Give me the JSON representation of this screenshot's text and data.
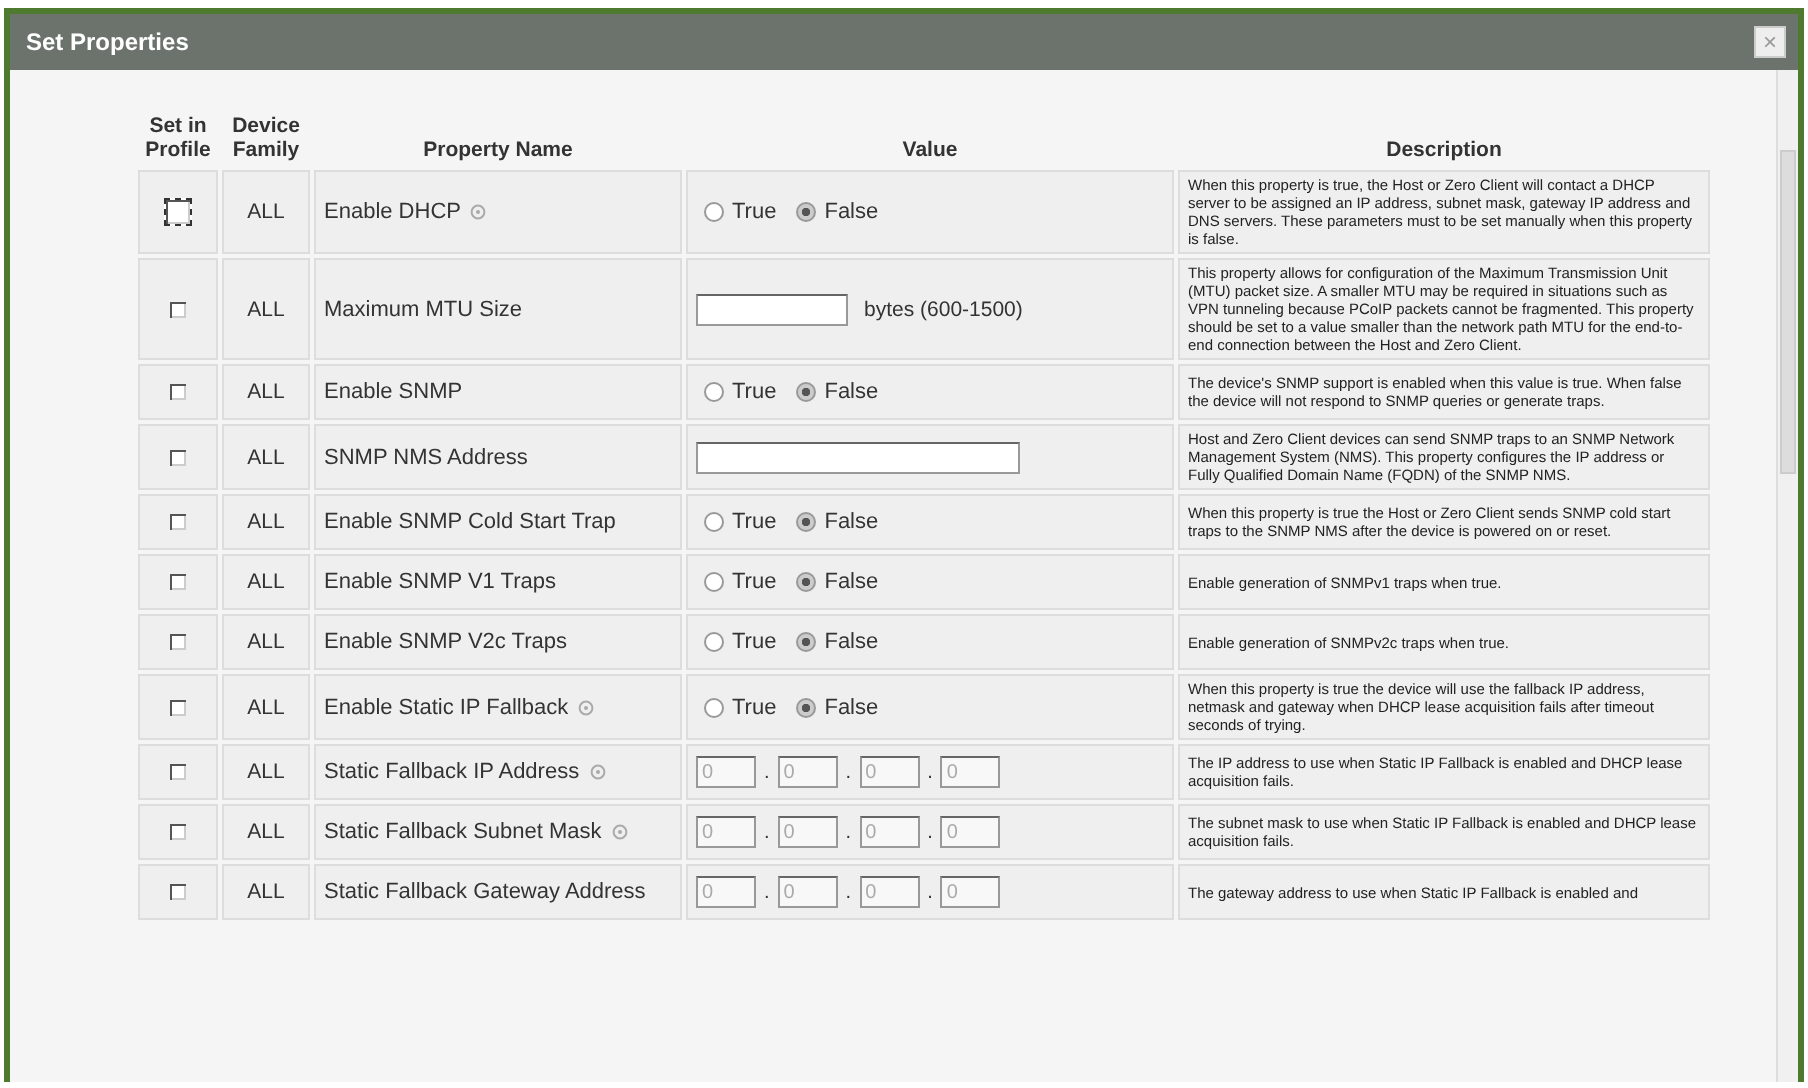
{
  "window": {
    "title": "Set Properties",
    "close": "×"
  },
  "columns": [
    "Set in Profile",
    "Device Family",
    "Property Name",
    "Value",
    "Description"
  ],
  "rows": [
    {
      "kind": "radio",
      "in_profile": false,
      "focused": true,
      "family": "ALL",
      "name": "Enable DHCP",
      "info": true,
      "options": [
        {
          "label": "True",
          "selected": false
        },
        {
          "label": "False",
          "selected": true
        }
      ],
      "description": "When this property is true, the Host or Zero Client will contact a DHCP server to be assigned an IP address, subnet mask, gateway IP address and DNS servers. These parameters must to be set manually when this property is false."
    },
    {
      "kind": "number",
      "in_profile": false,
      "focused": false,
      "family": "ALL",
      "name": "Maximum MTU Size",
      "info": false,
      "unit": "bytes (600-1500)",
      "description": "This property allows for configuration of the Maximum Transmission Unit (MTU) packet size. A smaller MTU may be required in situations such as VPN tunneling because PCoIP packets cannot be fragmented. This property should be set to a value smaller than the network path MTU for the end-to-end connection between the Host and Zero Client."
    },
    {
      "kind": "radio",
      "in_profile": false,
      "focused": false,
      "family": "ALL",
      "name": "Enable SNMP",
      "info": false,
      "options": [
        {
          "label": "True",
          "selected": false
        },
        {
          "label": "False",
          "selected": true
        }
      ],
      "description": "The device's SNMP support is enabled when this value is true. When false the device will not respond to SNMP queries or generate traps."
    },
    {
      "kind": "text",
      "in_profile": false,
      "focused": false,
      "family": "ALL",
      "name": "SNMP NMS Address",
      "info": false,
      "description": "Host and Zero Client devices can send SNMP traps to an SNMP Network Management System (NMS). This property configures the IP address or Fully Qualified Domain Name (FQDN) of the SNMP NMS."
    },
    {
      "kind": "radio",
      "in_profile": false,
      "focused": false,
      "family": "ALL",
      "name": "Enable SNMP Cold Start Trap",
      "info": false,
      "options": [
        {
          "label": "True",
          "selected": false
        },
        {
          "label": "False",
          "selected": true
        }
      ],
      "description": "When this property is true the Host or Zero Client sends SNMP cold start traps to the SNMP NMS after the device is powered on or reset."
    },
    {
      "kind": "radio",
      "in_profile": false,
      "focused": false,
      "family": "ALL",
      "name": "Enable SNMP V1 Traps",
      "info": false,
      "options": [
        {
          "label": "True",
          "selected": false
        },
        {
          "label": "False",
          "selected": true
        }
      ],
      "description": "Enable generation of SNMPv1 traps when true."
    },
    {
      "kind": "radio",
      "in_profile": false,
      "focused": false,
      "family": "ALL",
      "name": "Enable SNMP V2c Traps",
      "info": false,
      "options": [
        {
          "label": "True",
          "selected": false
        },
        {
          "label": "False",
          "selected": true
        }
      ],
      "description": "Enable generation of SNMPv2c traps when true."
    },
    {
      "kind": "radio",
      "in_profile": false,
      "focused": false,
      "family": "ALL",
      "name": "Enable Static IP Fallback",
      "info": true,
      "options": [
        {
          "label": "True",
          "selected": false
        },
        {
          "label": "False",
          "selected": true
        }
      ],
      "description": "When this property is true the device will use the fallback IP address, netmask and gateway when DHCP lease acquisition fails after timeout seconds of trying."
    },
    {
      "kind": "ip",
      "in_profile": false,
      "focused": false,
      "family": "ALL",
      "name": "Static Fallback IP Address",
      "info": true,
      "disabled": true,
      "octets": [
        "0",
        "0",
        "0",
        "0"
      ],
      "separator": ".",
      "description": "The IP address to use when Static IP Fallback is enabled and DHCP lease acquisition fails."
    },
    {
      "kind": "ip",
      "in_profile": false,
      "focused": false,
      "family": "ALL",
      "name": "Static Fallback Subnet Mask",
      "info": true,
      "disabled": true,
      "octets": [
        "0",
        "0",
        "0",
        "0"
      ],
      "separator": ".",
      "description": "The subnet mask to use when Static IP Fallback is enabled and DHCP lease acquisition fails."
    },
    {
      "kind": "ip",
      "in_profile": false,
      "focused": false,
      "family": "ALL",
      "name": "Static Fallback Gateway Address",
      "info": false,
      "disabled": true,
      "octets": [
        "0",
        "0",
        "0",
        "0"
      ],
      "separator": ".",
      "description": "The gateway address to use when Static IP Fallback is enabled and"
    }
  ]
}
